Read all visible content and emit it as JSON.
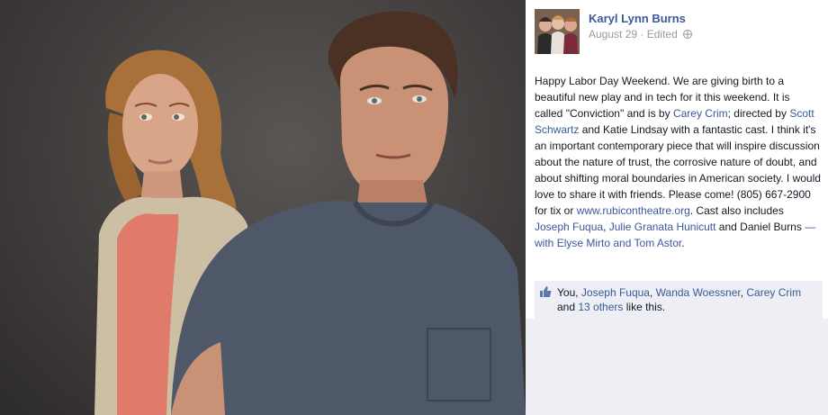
{
  "post": {
    "author": "Karyl Lynn Burns",
    "date": "August 29",
    "edited_label": "Edited",
    "visibility_icon": "globe-icon",
    "body": {
      "p1": "Happy Labor Day Weekend. We are giving birth to a beautiful new play and in tech for it this weekend. It is called \"Conviction\" and is by ",
      "link_carey": "Carey Crim",
      "p2": "; directed by ",
      "link_scott": "Scott Schwartz",
      "p3": " and Katie Lindsay with a fantastic cast. I think it's an important contemporary piece that will inspire discussion about the nature of trust, the corrosive nature of doubt, and about shifting moral boundaries in American society. I would love to share it with friends. Please come! (805) 667-2900 for tix or ",
      "link_site": "www.rubicontheatre.org",
      "p4": ". Cast also includes ",
      "link_joseph": "Joseph Fuqua",
      "p5": ", ",
      "link_julie": "Julie Granata Hunicutt",
      "p6": " and Daniel Burns",
      "with_label": " — with ",
      "link_elyse": "Elyse Mirto",
      "and_label": " and ",
      "link_tom": "Tom Astor",
      "end": "."
    }
  },
  "likes": {
    "icon": "like-thumb-icon",
    "you": "You, ",
    "name1": "Joseph Fuqua",
    "sep1": ", ",
    "name2": "Wanda Woessner",
    "sep2": ", ",
    "name3": "Carey Crim",
    "and": " and ",
    "others": "13 others",
    "suffix": " like this."
  },
  "colors": {
    "link": "#3b5998",
    "likes_bg": "#edeff4",
    "meta": "#999999"
  }
}
